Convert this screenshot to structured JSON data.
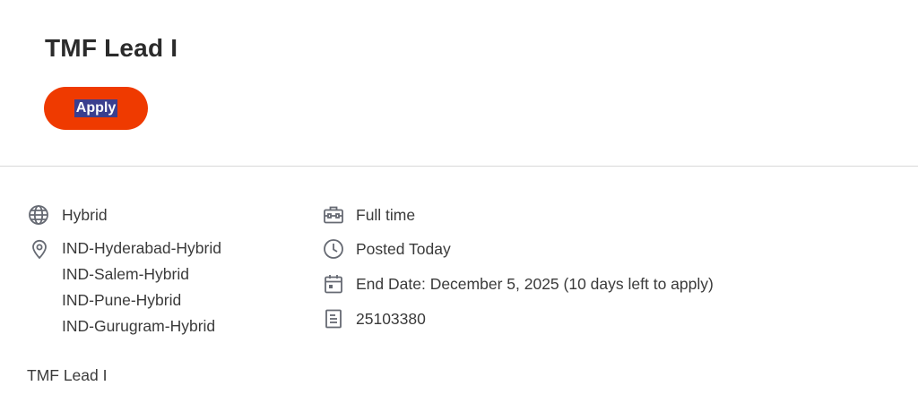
{
  "job": {
    "title": "TMF Lead I",
    "apply_label": "Apply",
    "accent_color": "#ef3a00"
  },
  "details": {
    "remote_type": "Hybrid",
    "locations": [
      "IND-Hyderabad-Hybrid",
      "IND-Salem-Hybrid",
      "IND-Pune-Hybrid",
      "IND-Gurugram-Hybrid"
    ],
    "time_type": "Full time",
    "posted": "Posted Today",
    "end_date": "End Date: December 5, 2025 (10 days left to apply)",
    "job_id": "25103380"
  },
  "icons": {
    "remote": "globe-icon",
    "location": "location-pin-icon",
    "time_type": "briefcase-icon",
    "posted": "clock-icon",
    "end_date": "calendar-icon",
    "job_id": "document-icon"
  },
  "description": {
    "text": "TMF Lead I"
  }
}
